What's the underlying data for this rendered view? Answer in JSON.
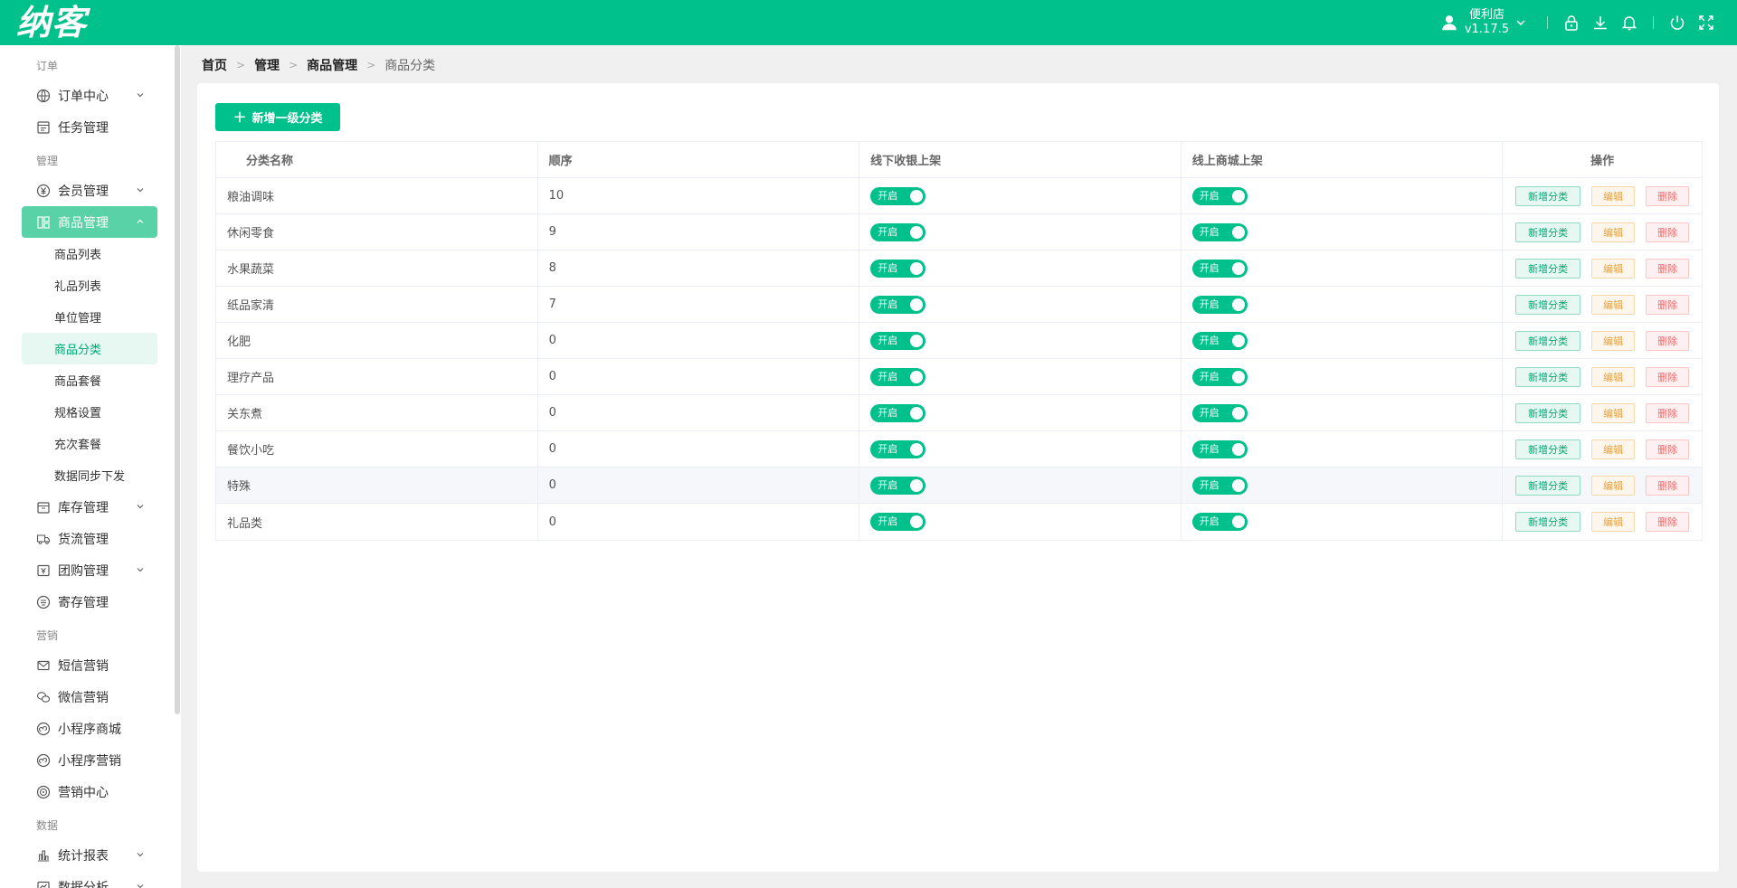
{
  "app": {
    "logo": "纳客",
    "store": "便利店",
    "version": "v1.17.5"
  },
  "topbar_icons": [
    "user-icon",
    "lock-icon",
    "download-icon",
    "bell-icon",
    "power-icon",
    "fullscreen-icon"
  ],
  "sidebar": {
    "sec_order": "订单",
    "order_center": "订单中心",
    "task_mgmt": "任务管理",
    "sec_manage": "管理",
    "member_mgmt": "会员管理",
    "goods_mgmt": "商品管理",
    "goods_sub": [
      "商品列表",
      "礼品列表",
      "单位管理",
      "商品分类",
      "商品套餐",
      "规格设置",
      "充次套餐",
      "数据同步下发"
    ],
    "stock_mgmt": "库存管理",
    "logistics_mgmt": "货流管理",
    "group_mgmt": "团购管理",
    "deposit_mgmt": "寄存管理",
    "sec_marketing": "营销",
    "sms": "短信营销",
    "wechat": "微信营销",
    "mini_mall": "小程序商城",
    "mini_marketing": "小程序营销",
    "marketing_center": "营销中心",
    "sec_data": "数据",
    "stats": "统计报表",
    "analysis": "数据分析"
  },
  "breadcrumb": [
    "首页",
    "管理",
    "商品管理",
    "商品分类"
  ],
  "add_button": "新增一级分类",
  "table": {
    "headers": [
      "分类名称",
      "顺序",
      "线下收银上架",
      "线上商城上架",
      "操作"
    ],
    "toggle_label": "开启",
    "actions": {
      "add": "新增分类",
      "edit": "编辑",
      "delete": "删除"
    },
    "rows": [
      {
        "name": "粮油调味",
        "order": "10"
      },
      {
        "name": "休闲零食",
        "order": "9"
      },
      {
        "name": "水果蔬菜",
        "order": "8"
      },
      {
        "name": "纸品家清",
        "order": "7"
      },
      {
        "name": "化肥",
        "order": "0"
      },
      {
        "name": "理疗产品",
        "order": "0"
      },
      {
        "name": "关东煮",
        "order": "0"
      },
      {
        "name": "餐饮小吃",
        "order": "0"
      },
      {
        "name": "特殊",
        "order": "0"
      },
      {
        "name": "礼品类",
        "order": "0"
      }
    ]
  },
  "colors": {
    "brand": "#00c08b",
    "edit": "#e6a23c",
    "delete": "#f56c6c"
  }
}
